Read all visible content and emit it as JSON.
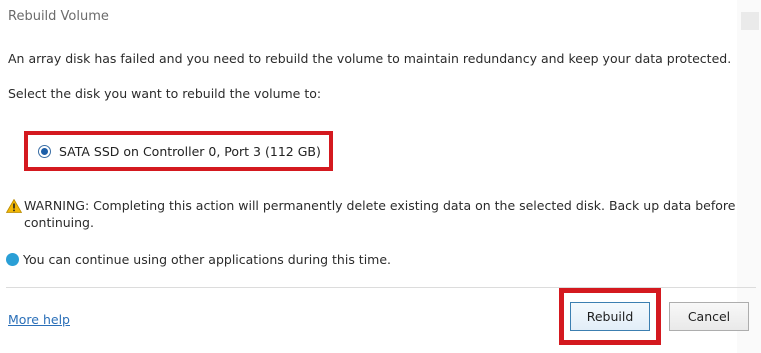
{
  "dialog": {
    "title": "Rebuild Volume",
    "intro": "An array disk has failed and you need to rebuild the volume to maintain redundancy and keep your data protected.",
    "select_prompt": "Select the disk you want to rebuild the volume to:",
    "disk_option": {
      "label": "SATA SSD on Controller 0, Port 3 (112 GB)",
      "selected": true
    },
    "warning": "WARNING: Completing this action will permanently delete existing data on the selected disk. Back up data before continuing.",
    "info": "You can continue using other applications during this time.",
    "more_help": "More help",
    "buttons": {
      "rebuild": "Rebuild",
      "cancel": "Cancel"
    }
  },
  "colors": {
    "highlight": "#d4191f",
    "link": "#2a6fb8",
    "radio_selected": "#1c5ea8",
    "info_icon": "#2a9fd6",
    "warning_icon": "#f2b705"
  },
  "icons": {
    "warning": "warning-icon",
    "info": "info-icon"
  }
}
